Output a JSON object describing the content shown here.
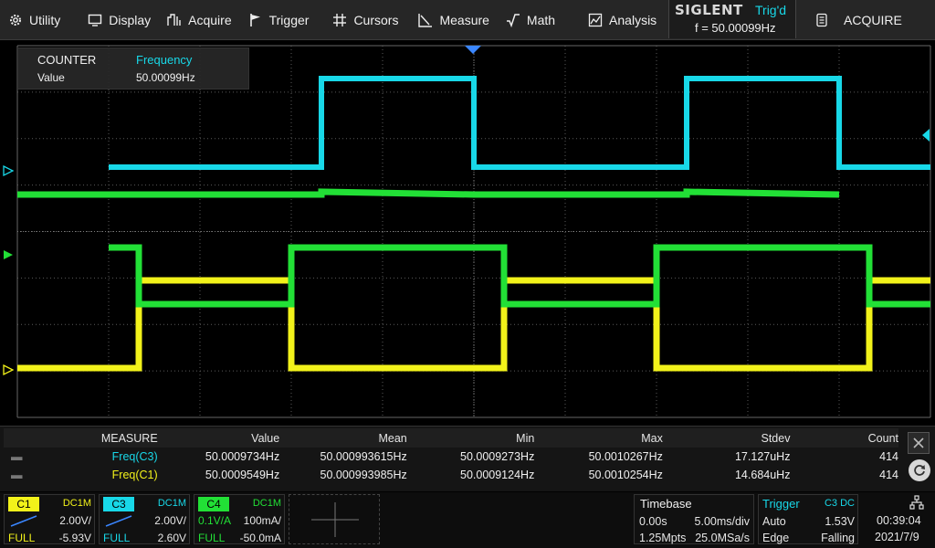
{
  "menu": {
    "items": [
      {
        "label": "Utility",
        "icon": "gear-icon"
      },
      {
        "label": "Display",
        "icon": "monitor-icon"
      },
      {
        "label": "Acquire",
        "icon": "acquire-icon"
      },
      {
        "label": "Trigger",
        "icon": "flag-icon"
      },
      {
        "label": "Cursors",
        "icon": "crosshair-icon"
      },
      {
        "label": "Measure",
        "icon": "measure-icon"
      },
      {
        "label": "Math",
        "icon": "math-icon"
      },
      {
        "label": "Analysis",
        "icon": "analysis-icon"
      }
    ],
    "brand": "SIGLENT",
    "trigger_state": "Trig'd",
    "frequency": "f = 50.00099Hz",
    "active_menu": "ACQUIRE"
  },
  "counter": {
    "title": "COUNTER",
    "type": "Frequency",
    "label": "Value",
    "value": "50.00099Hz"
  },
  "colors": {
    "c1": "#f2f21a",
    "c2": "#22e036",
    "c3": "#18d8e8",
    "c4": "#22e036",
    "trigger": "#18d8e8"
  },
  "measure": {
    "headers": [
      "MEASURE",
      "Value",
      "Mean",
      "Min",
      "Max",
      "Stdev",
      "Count"
    ],
    "rows": [
      {
        "source": "Freq(C3)",
        "value": "50.0009734Hz",
        "mean": "50.000993615Hz",
        "min": "50.0009273Hz",
        "max": "50.0010267Hz",
        "stdev": "17.127uHz",
        "count": "414",
        "color": "#18d8e8"
      },
      {
        "source": "Freq(C1)",
        "value": "50.0009549Hz",
        "mean": "50.000993985Hz",
        "min": "50.0009124Hz",
        "max": "50.0010254Hz",
        "stdev": "14.684uHz",
        "count": "414",
        "color": "#f2f21a"
      }
    ]
  },
  "channels": {
    "c1": {
      "tag": "C1",
      "coupling": "DC1M",
      "scale": "2.00V/",
      "bw": "FULL",
      "offset": "-5.93V"
    },
    "c3": {
      "tag": "C3",
      "coupling": "DC1M",
      "scale": "2.00V/",
      "bw": "FULL",
      "offset": "2.60V"
    },
    "c4": {
      "tag": "C4",
      "coupling": "DC1M",
      "probe": "0.1V/A",
      "scale": "100mA/",
      "bw": "FULL",
      "offset": "-50.0mA"
    }
  },
  "timebase": {
    "title": "Timebase",
    "delay": "0.00s",
    "scale": "5.00ms/div",
    "memory": "1.25Mpts",
    "sample_rate": "25.0MSa/s"
  },
  "trigger": {
    "title": "Trigger",
    "source": "C3 DC",
    "mode": "Auto",
    "level": "1.53V",
    "type": "Edge",
    "slope": "Falling"
  },
  "clock": {
    "time": "00:39:04",
    "date": "2021/7/9"
  }
}
